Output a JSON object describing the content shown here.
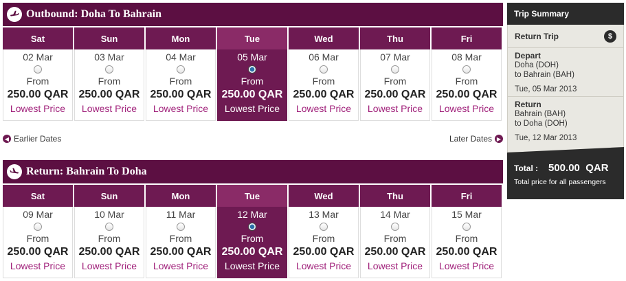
{
  "outbound": {
    "title": "Outbound: Doha To Bahrain",
    "days": [
      {
        "day": "Sat",
        "date": "02 Mar",
        "from": "From",
        "price": "250.00 QAR",
        "tag": "Lowest Price",
        "selected": false
      },
      {
        "day": "Sun",
        "date": "03 Mar",
        "from": "From",
        "price": "250.00 QAR",
        "tag": "Lowest Price",
        "selected": false
      },
      {
        "day": "Mon",
        "date": "04 Mar",
        "from": "From",
        "price": "250.00 QAR",
        "tag": "Lowest Price",
        "selected": false
      },
      {
        "day": "Tue",
        "date": "05 Mar",
        "from": "From",
        "price": "250.00 QAR",
        "tag": "Lowest Price",
        "selected": true
      },
      {
        "day": "Wed",
        "date": "06 Mar",
        "from": "From",
        "price": "250.00 QAR",
        "tag": "Lowest Price",
        "selected": false
      },
      {
        "day": "Thu",
        "date": "07 Mar",
        "from": "From",
        "price": "250.00 QAR",
        "tag": "Lowest Price",
        "selected": false
      },
      {
        "day": "Fri",
        "date": "08 Mar",
        "from": "From",
        "price": "250.00 QAR",
        "tag": "Lowest Price",
        "selected": false
      }
    ]
  },
  "nav": {
    "earlier": "Earlier Dates",
    "later": "Later Dates"
  },
  "return": {
    "title": "Return: Bahrain To Doha",
    "days": [
      {
        "day": "Sat",
        "date": "09 Mar",
        "from": "From",
        "price": "250.00 QAR",
        "tag": "Lowest Price",
        "selected": false
      },
      {
        "day": "Sun",
        "date": "10 Mar",
        "from": "From",
        "price": "250.00 QAR",
        "tag": "Lowest Price",
        "selected": false
      },
      {
        "day": "Mon",
        "date": "11 Mar",
        "from": "From",
        "price": "250.00 QAR",
        "tag": "Lowest Price",
        "selected": false
      },
      {
        "day": "Tue",
        "date": "12 Mar",
        "from": "From",
        "price": "250.00 QAR",
        "tag": "Lowest Price",
        "selected": true
      },
      {
        "day": "Wed",
        "date": "13 Mar",
        "from": "From",
        "price": "250.00 QAR",
        "tag": "Lowest Price",
        "selected": false
      },
      {
        "day": "Thu",
        "date": "14 Mar",
        "from": "From",
        "price": "250.00 QAR",
        "tag": "Lowest Price",
        "selected": false
      },
      {
        "day": "Fri",
        "date": "15 Mar",
        "from": "From",
        "price": "250.00 QAR",
        "tag": "Lowest Price",
        "selected": false
      }
    ]
  },
  "summary": {
    "title": "Trip Summary",
    "trip_type": "Return Trip",
    "info_icon": "$",
    "depart": {
      "label": "Depart",
      "origin": "Doha (DOH)",
      "destination": "to Bahrain (BAH)",
      "date": "Tue, 05 Mar 2013"
    },
    "return": {
      "label": "Return",
      "origin": "Bahrain (BAH)",
      "destination": "to Doha (DOH)",
      "date": "Tue, 12 Mar 2013"
    },
    "total_label": "Total :",
    "total_amount": "500.00",
    "total_currency": "QAR",
    "total_note": "Total price for all passengers"
  },
  "colors": {
    "header": "#5c0f42",
    "day_header": "#6e1a52",
    "lowest_price_text": "#a0207a",
    "summary_dark": "#2b2b2b",
    "summary_panel": "#e9e8e2"
  },
  "icons": {
    "outbound": "plane-takeoff-icon",
    "return": "plane-landing-icon",
    "earlier": "chevron-left-icon",
    "later": "chevron-right-icon",
    "info": "dollar-info-icon"
  }
}
